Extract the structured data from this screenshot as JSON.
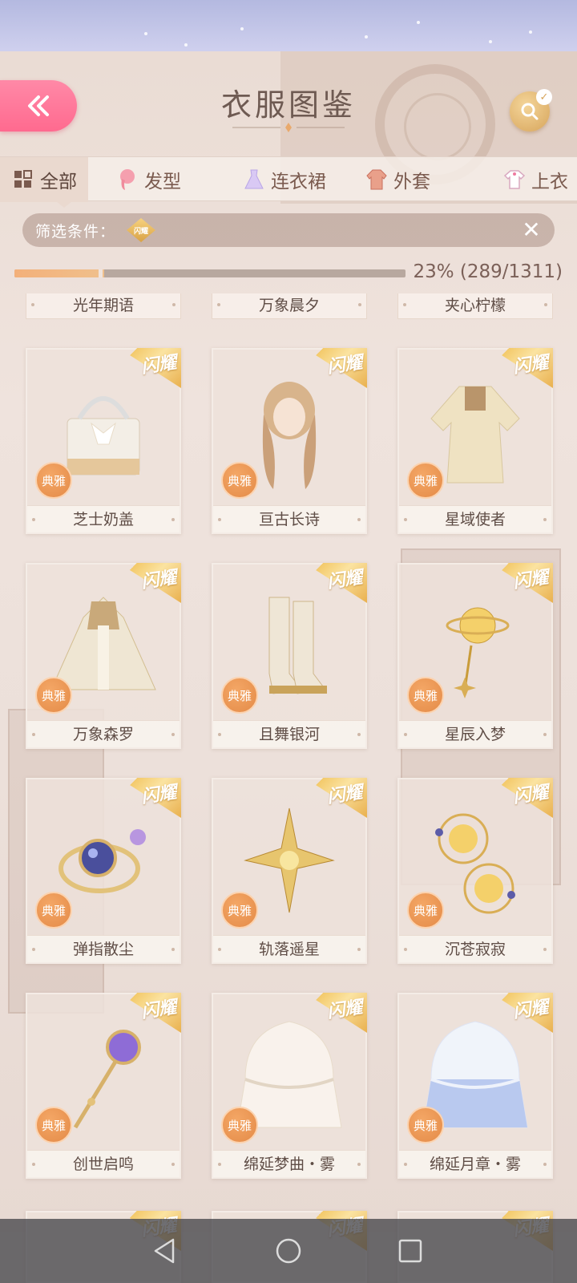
{
  "header": {
    "title": "衣服图鉴"
  },
  "tabs": [
    {
      "label": "全部",
      "icon": "grid-icon",
      "active": true
    },
    {
      "label": "发型",
      "icon": "hair-icon"
    },
    {
      "label": "连衣裙",
      "icon": "dress-icon"
    },
    {
      "label": "外套",
      "icon": "coat-icon"
    },
    {
      "label": "上衣",
      "icon": "shirt-icon"
    }
  ],
  "filter": {
    "label": "筛选条件：",
    "chip": "闪耀"
  },
  "progress": {
    "percent": 23,
    "text": "23% (289/1311)"
  },
  "peek_items": [
    "光年期语",
    "万象晨夕",
    "夹心柠檬"
  ],
  "ribbon_text": "闪耀",
  "badge_text": "典雅",
  "items": [
    {
      "name": "芝士奶盖",
      "icon": "handbag-icon"
    },
    {
      "name": "亘古长诗",
      "icon": "long-hair-icon"
    },
    {
      "name": "星域使者",
      "icon": "coat-icon"
    },
    {
      "name": "万象森罗",
      "icon": "cape-icon"
    },
    {
      "name": "且舞银河",
      "icon": "boots-icon"
    },
    {
      "name": "星辰入梦",
      "icon": "star-earring-icon"
    },
    {
      "name": "弹指散尘",
      "icon": "ring-icon"
    },
    {
      "name": "轨落遥星",
      "icon": "star-pin-icon"
    },
    {
      "name": "沉苍寂寂",
      "icon": "orbit-earring-icon"
    },
    {
      "name": "创世启鸣",
      "icon": "scepter-icon"
    },
    {
      "name": "绵延梦曲・雾",
      "icon": "veil-icon"
    },
    {
      "name": "绵延月章・雾",
      "icon": "blue-veil-icon"
    }
  ],
  "colors": {
    "accent_pink": "#ff6a8f",
    "gold": "#e9b04e",
    "badge_orange": "#e48b48"
  }
}
